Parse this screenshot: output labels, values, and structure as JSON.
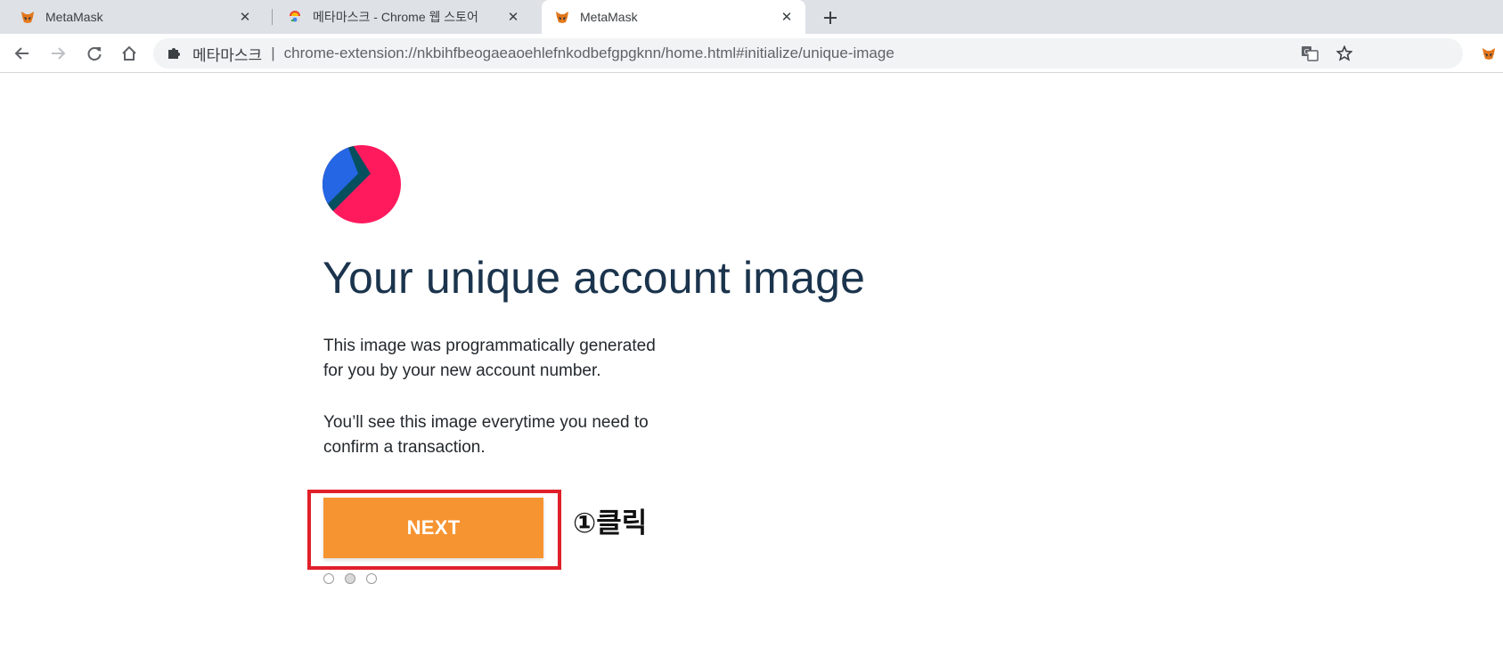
{
  "tabs": [
    {
      "title": "MetaMask",
      "icon": "metamask-fox-icon",
      "active": false
    },
    {
      "title": "메타마스크 - Chrome 웹 스토어",
      "icon": "chrome-web-store-icon",
      "active": false
    },
    {
      "title": "MetaMask",
      "icon": "metamask-fox-icon",
      "active": true
    }
  ],
  "toolbar": {
    "extension_name": "메타마스크",
    "separator": "|",
    "url": "chrome-extension://nkbihfbeogaeaoehlefnkodbefgpgknn/home.html#initialize/unique-image"
  },
  "page": {
    "heading": "Your unique account image",
    "paragraph_1_line_1": "This image was programmatically generated",
    "paragraph_1_line_2": "for you by your new account number.",
    "paragraph_2_line_1": "You’ll see this image everytime you need to",
    "paragraph_2_line_2": "confirm a transaction.",
    "next_label": "NEXT",
    "annotation": "①클릭",
    "steps_total": 3,
    "steps_current": 2
  },
  "colors": {
    "accent_orange": "#f79432",
    "highlight_red": "#e0202a",
    "heading_navy": "#1b344d",
    "identicon_pink": "#ff1a5e",
    "identicon_blue": "#2566e4",
    "identicon_teal": "#064f5e"
  }
}
